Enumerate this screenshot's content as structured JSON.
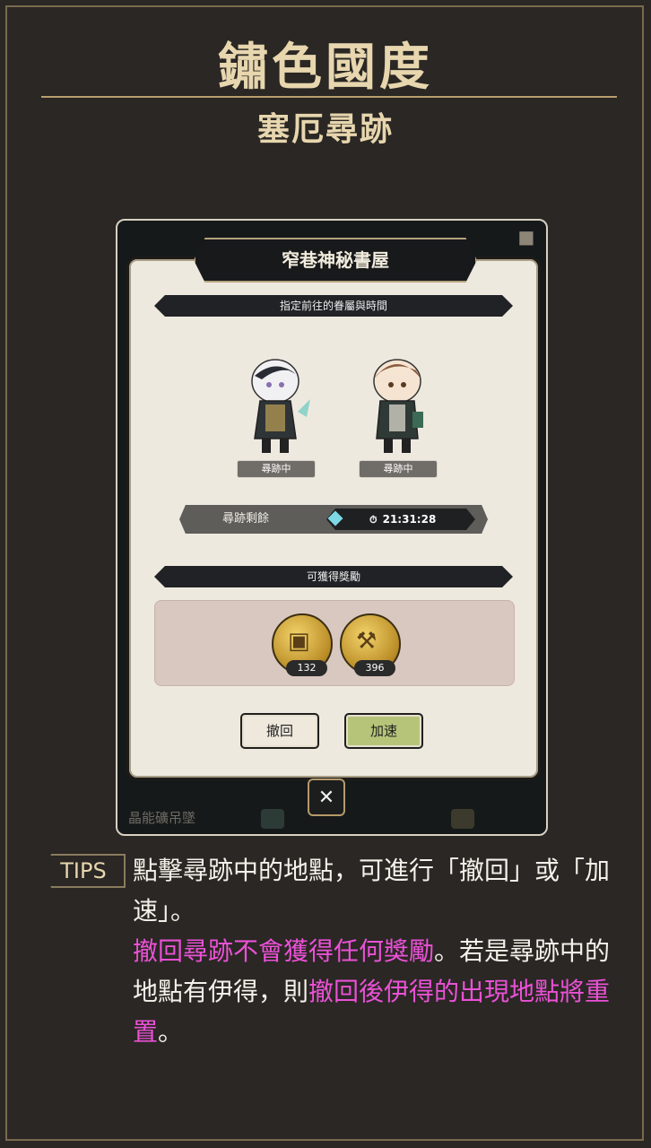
{
  "header": {
    "title": "鏽色國度",
    "subtitle": "塞厄尋跡"
  },
  "screenshot": {
    "dialog_title": "窄巷神秘書屋",
    "assign_banner": "指定前往的眷屬與時間",
    "characters": [
      {
        "status": "尋跡中"
      },
      {
        "status": "尋跡中"
      }
    ],
    "timer": {
      "label": "尋跡剩餘",
      "value": "21:31:28"
    },
    "rewards_banner": "可獲得獎勵",
    "rewards": [
      {
        "count": "132"
      },
      {
        "count": "396"
      }
    ],
    "buttons": {
      "cancel": "撤回",
      "speed_up": "加速",
      "close": "✕"
    },
    "background_text": "晶能礦吊墜"
  },
  "tips": {
    "tag": "TIPS",
    "line1": "點擊尋跡中的地點，可進行「撤回」或「加速」。",
    "highlight1": "撤回尋跡不會獲得任何獎勵",
    "mid": "。若是尋跡中的地點有伊得，則",
    "highlight2": "撤回後伊得的出現地點將重置",
    "end": "。"
  },
  "colors": {
    "accent_gold": "#e7d6ae",
    "highlight_pink": "#ea51d6",
    "speed_button": "#b6c47a"
  }
}
